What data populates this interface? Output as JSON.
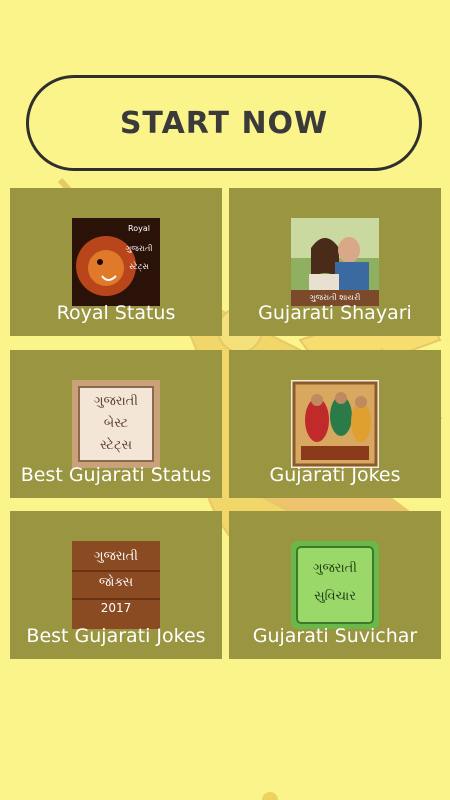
{
  "start_button": {
    "label": "START NOW"
  },
  "colors": {
    "background": "#fbf48a",
    "tile": "#9a9540",
    "tile_text": "#ffffff"
  },
  "tiles": [
    {
      "label": "Royal Status",
      "icon": "lion-icon",
      "thumb_lines": [
        "Royal",
        "ગુજરાતી",
        "સ્ટેટ્સ"
      ]
    },
    {
      "label": "Gujarati Shayari",
      "icon": "couple-photo-icon",
      "thumb_lines": [
        "ગુજરાતી શાયરી"
      ]
    },
    {
      "label": "Best Gujarati Status",
      "icon": "framed-text-icon",
      "thumb_lines": [
        "ગુજરાતી",
        "બેસ્ટ",
        "સ્ટેટ્સ"
      ]
    },
    {
      "label": "Gujarati Jokes",
      "icon": "painting-icon",
      "thumb_lines": []
    },
    {
      "label": "Best Gujarati Jokes",
      "icon": "wood-board-icon",
      "thumb_lines": [
        "ગુજરાતી",
        "જોક્સ",
        "2017"
      ]
    },
    {
      "label": "Gujarati Suvichar",
      "icon": "green-frame-icon",
      "thumb_lines": [
        "ગુજરાતી",
        "સુવિચાર"
      ]
    }
  ]
}
